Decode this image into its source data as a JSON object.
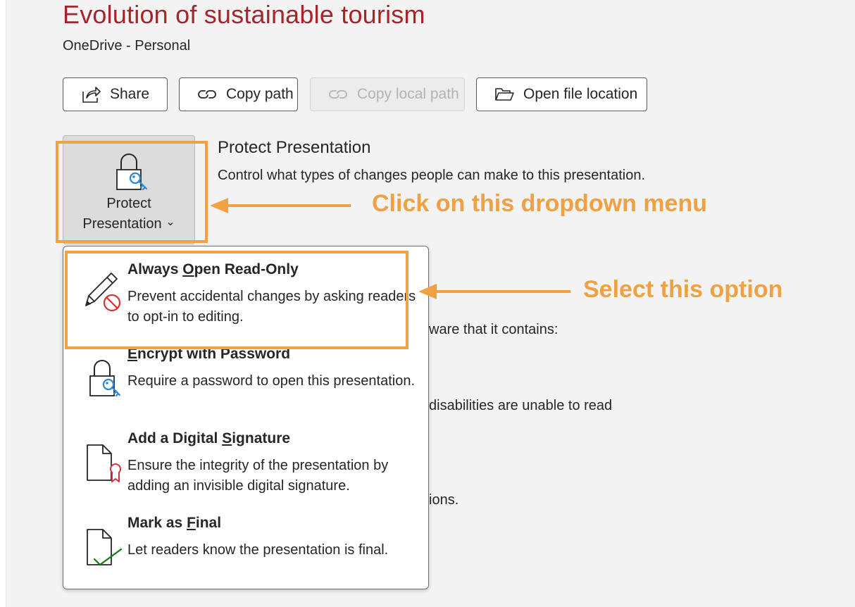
{
  "header": {
    "title": "Evolution of sustainable tourism",
    "location": "OneDrive - Personal"
  },
  "buttons": {
    "share": "Share",
    "copy_path": "Copy path",
    "copy_local_path": "Copy local path",
    "open_file_location": "Open file location"
  },
  "protect": {
    "label_line1": "Protect",
    "label_line2": "Presentation",
    "chevron": "⌄",
    "title": "Protect Presentation",
    "description": "Control what types of changes people can make to this presentation."
  },
  "background_fragments": {
    "inspect": "ware that it contains:",
    "accessibility": "disabilities are unable to read",
    "versions": "ions."
  },
  "menu": {
    "items": [
      {
        "title_pre": "Always ",
        "title_key": "O",
        "title_post": "pen Read-Only",
        "description": "Prevent accidental changes by asking readers to opt-in to editing.",
        "icon": "pencil-no-edit-icon"
      },
      {
        "title_pre": "",
        "title_key": "E",
        "title_post": "ncrypt with Password",
        "description": "Require a password to open this presentation.",
        "icon": "lock-key-icon"
      },
      {
        "title_pre": "Add a Digital ",
        "title_key": "S",
        "title_post": "ignature",
        "description": "Ensure the integrity of the presentation by adding an invisible digital signature.",
        "icon": "document-ribbon-icon"
      },
      {
        "title_pre": "Mark as ",
        "title_key": "F",
        "title_post": "inal",
        "description": "Let readers know the presentation is final.",
        "icon": "document-check-icon"
      }
    ]
  },
  "annotations": {
    "click_dropdown": "Click on this dropdown menu",
    "select_option": "Select this option"
  },
  "colors": {
    "title_red": "#a4262c",
    "annotation_orange": "#f0a143",
    "icon_blue": "#2b88d8",
    "no_symbol_red": "#d13438",
    "check_green": "#107c10"
  }
}
